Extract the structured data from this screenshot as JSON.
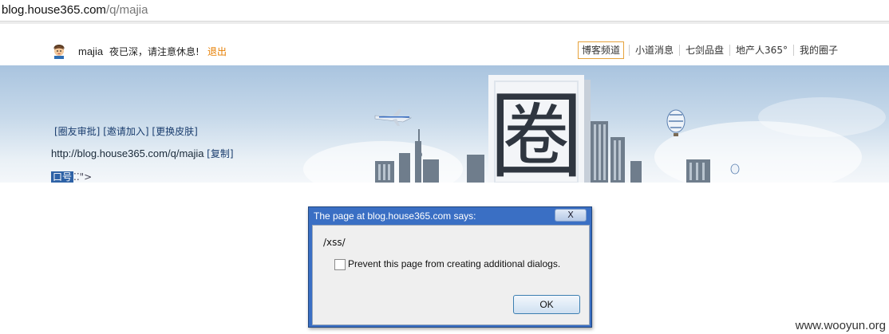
{
  "address_bar": {
    "host": "blog.house365.com",
    "path": "/q/majia"
  },
  "header": {
    "username": "majia",
    "greeting": "夜已深，请注意休息!",
    "logout_label": "退出",
    "nav": [
      "博客频道",
      "小道消息",
      "七剑品盘",
      "地产人365°",
      "我的圈子"
    ],
    "active_nav": "博客频道"
  },
  "banner": {
    "admin_links": [
      "[圈友审批]",
      "[邀请加入]",
      "[更换皮肤]"
    ],
    "blog_url": "http://blog.house365.com/q/majia",
    "copy_label": "[复制]",
    "slogan_tag": "口号",
    "slogan_text": "\">",
    "big_char": "圈"
  },
  "dialog": {
    "title": "The page at blog.house365.com says:",
    "close_label": "X",
    "message": "/xss/",
    "checkbox_label": "Prevent this page from creating additional dialogs.",
    "checkbox_checked": false,
    "ok_label": "OK"
  },
  "watermark": "www.wooyun.org",
  "colors": {
    "accent": "#e67e00",
    "link": "#1a3d6e",
    "dialog_title_bg": "#3a6fc4"
  }
}
